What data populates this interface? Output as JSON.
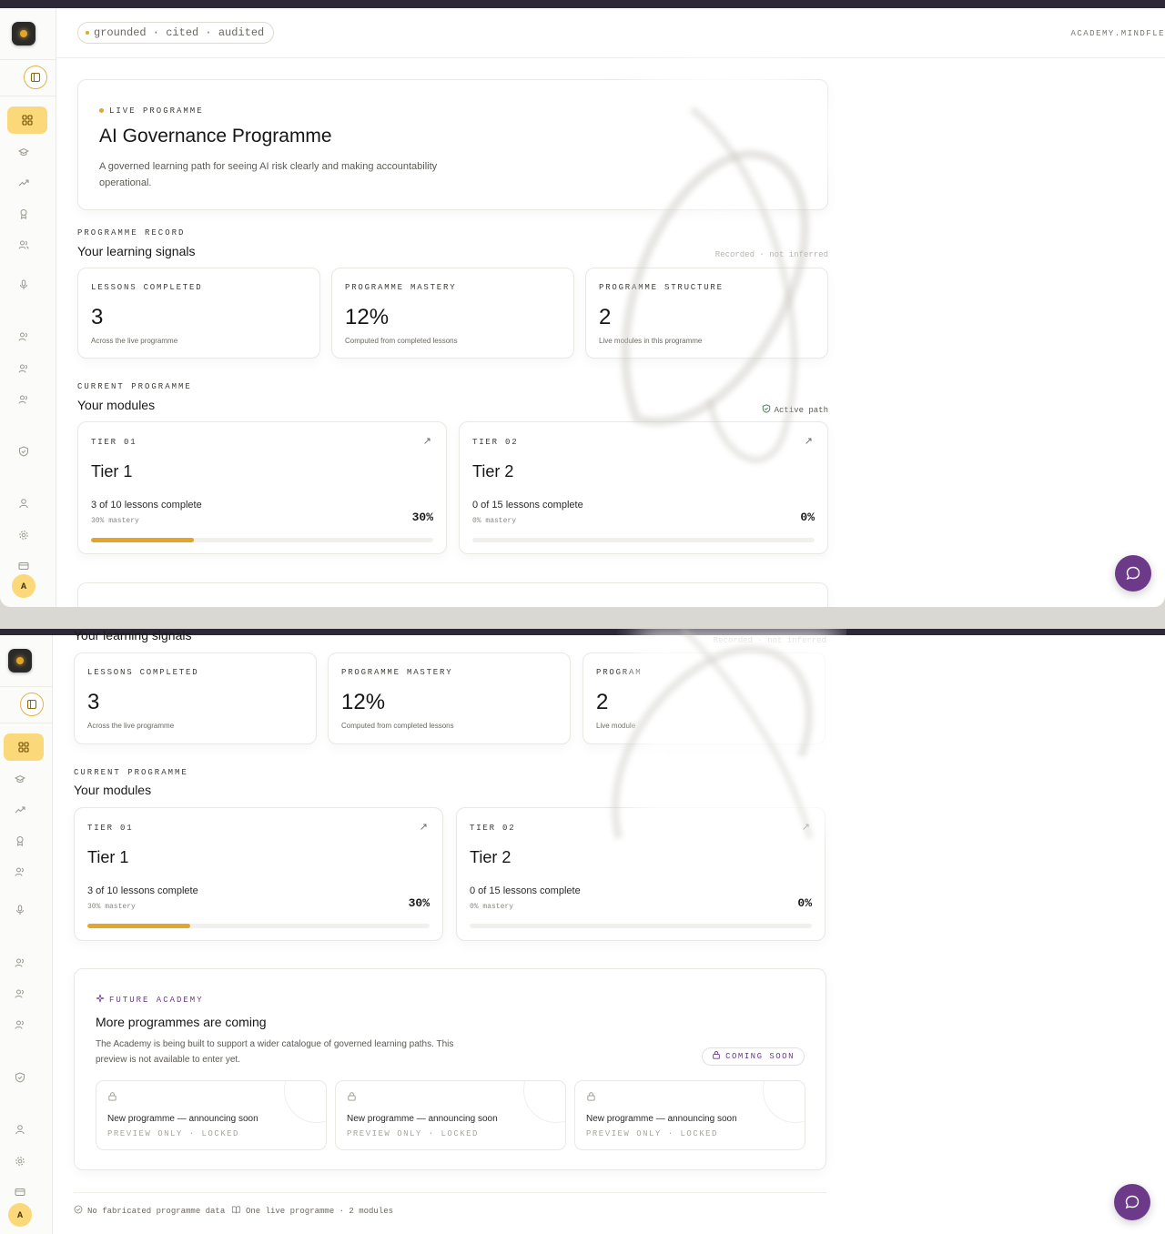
{
  "header": {
    "trust_pill": "grounded · cited · audited",
    "host": "ACADEMY.MINDFLE"
  },
  "hero": {
    "eyebrow": "LIVE PROGRAMME",
    "title": "AI Governance Programme",
    "description": "A governed learning path for seeing AI risk clearly and making accountability operational."
  },
  "signals": {
    "eyebrow": "PROGRAMME RECORD",
    "title": "Your learning signals",
    "note": "Recorded · not inferred",
    "cards": [
      {
        "label": "LESSONS COMPLETED",
        "value": "3",
        "sub": "Across the live programme"
      },
      {
        "label": "PROGRAMME MASTERY",
        "value": "12%",
        "sub": "Computed from completed lessons"
      },
      {
        "label": "PROGRAMME STRUCTURE",
        "value": "2",
        "sub": "Live modules in this programme"
      }
    ],
    "partial_label": "PROGRAM",
    "partial_sub": "Live module"
  },
  "modules": {
    "eyebrow": "CURRENT PROGRAMME",
    "title": "Your modules",
    "status": "Active path",
    "items": [
      {
        "tier": "TIER 01",
        "title": "Tier 1",
        "lessons": "3 of 10 lessons complete",
        "mastery": "30% mastery",
        "percent": "30%",
        "progress": 0.3
      },
      {
        "tier": "TIER 02",
        "title": "Tier 2",
        "lessons": "0 of 15 lessons complete",
        "mastery": "0% mastery",
        "percent": "0%",
        "progress": 0.0
      }
    ]
  },
  "future": {
    "eyebrow": "FUTURE ACADEMY",
    "title": "More programmes are coming",
    "description": "The Academy is being built to support a wider catalogue of governed learning paths. This preview is not available to enter yet.",
    "badge": "COMING SOON",
    "previews": [
      {
        "title": "New programme — announcing soon",
        "sub": "PREVIEW ONLY · LOCKED"
      },
      {
        "title": "New programme — announcing soon",
        "sub": "PREVIEW ONLY · LOCKED"
      },
      {
        "title": "New programme — announcing soon",
        "sub": "PREVIEW ONLY · LOCKED"
      }
    ]
  },
  "footer": {
    "left": "No fabricated programme data",
    "right": "One live programme · 2 modules"
  },
  "sidebar": {
    "avatar_initial": "A",
    "icons": [
      "dashboard-icon",
      "graduation-cap-icon",
      "trending-up-icon",
      "award-icon",
      "users-icon",
      "microphone-icon",
      "team-icon",
      "group-icon",
      "people-icon",
      "shield-check-icon",
      "user-icon",
      "settings-icon",
      "credit-card-icon"
    ]
  },
  "colors": {
    "accent": "#e3a52a",
    "active_nav": "#fbd97a",
    "brand_purple": "#6d3a8a"
  }
}
